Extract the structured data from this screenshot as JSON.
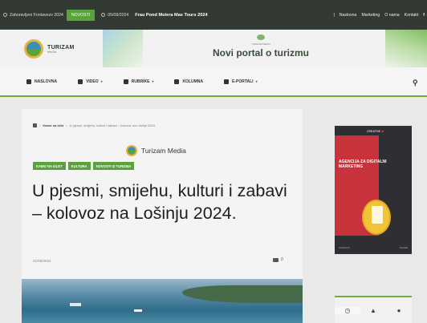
{
  "topbar": {
    "left_item": "Zaboravljeni Fontavezo 2024",
    "news_tag": "NOVOSTI",
    "news_date": "05/09/2024",
    "news_title": "Frau Pond Molera Mas Tours 2024",
    "links": [
      "Naslovna",
      "Marketing",
      "O nama",
      "Kontakt"
    ],
    "social": "f"
  },
  "header": {
    "logo_text": "TURIZAM",
    "logo_sub": "media",
    "banner_small": "TURIZAM MEDIA",
    "banner_title": "Novi portal o turizmu"
  },
  "nav": {
    "items": [
      {
        "label": "NASLOVNA",
        "icon": "home-icon",
        "has_caret": false
      },
      {
        "label": "VIDEO",
        "icon": "video-icon",
        "has_caret": true
      },
      {
        "label": "RUBRIKE",
        "icon": "pin-icon",
        "has_caret": true
      },
      {
        "label": "KOLUMNA",
        "icon": "pen-icon",
        "has_caret": false
      },
      {
        "label": "E-PORTALI",
        "icon": "grid-icon",
        "has_caret": true
      }
    ],
    "caret": "▾",
    "search_icon": "⚲"
  },
  "article": {
    "breadcrumb_home": "home-icon",
    "breadcrumb_section": "Kamo na izlet",
    "breadcrumb_rest": "U pjesmi, smijehu, kulturi i zabavi – kolovoz na Lošinju 2024.",
    "author": "Turizam Media",
    "tags": [
      "KAMO NA IZLET",
      "KULTURA",
      "NOVOSTI IZ TURIZMA"
    ],
    "headline": "U pjesmi, smijehu, kulturi i zabavi – kolovoz na Lošinju 2024.",
    "date": "01/08/2024",
    "comment_count": "0"
  },
  "sidebar": {
    "ad": {
      "brand_prefix": "CREATIVE",
      "brand_mark": "✱",
      "text": "AGENCIJA ZA DIGITALNI MARKETING",
      "footer_left": "creativa.hr",
      "footer_right": "Kontakt"
    },
    "widget_tabs": [
      "◷",
      "▲",
      "●"
    ]
  },
  "colors": {
    "accent": "#5aa23b",
    "topbar_bg": "#333a33",
    "ad_red": "#c8323a"
  }
}
